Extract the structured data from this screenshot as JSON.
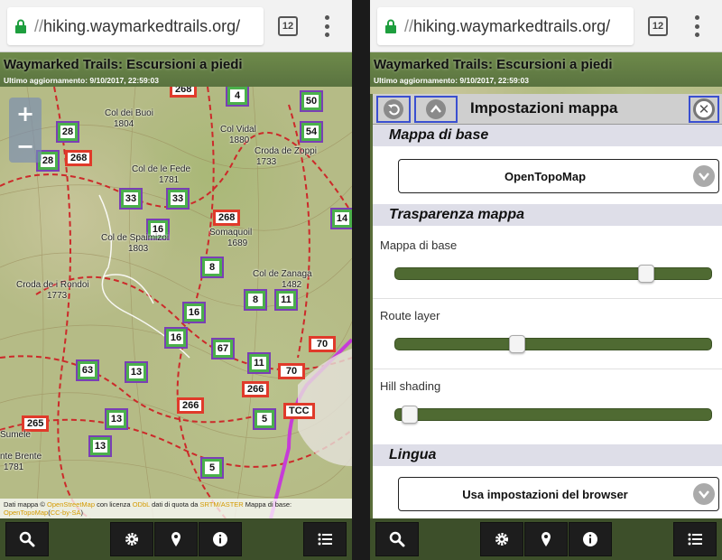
{
  "browser": {
    "url_scheme": "//",
    "url_host": "hiking.waymarkedtrails.org/",
    "tab_count": "12"
  },
  "header": {
    "title": "Waymarked Trails: Escursioni a piedi",
    "subtitle": "Ultimo aggiornamento: 9/10/2017, 22:59:03"
  },
  "map": {
    "zoom_in": "+",
    "zoom_out": "−",
    "routes_green": [
      "4",
      "50",
      "28",
      "54",
      "28",
      "33",
      "33",
      "16",
      "8",
      "8",
      "11",
      "16",
      "16",
      "67",
      "11",
      "63",
      "13",
      "13",
      "13",
      "5",
      "5",
      "14"
    ],
    "routes_red": [
      "268",
      "268",
      "268",
      "266",
      "266",
      "265",
      "70",
      "70",
      "TCC"
    ],
    "places": [
      "Col dei Buoi",
      "1804",
      "Col Vidal",
      "1880",
      "Croda de Zoppi",
      "1733",
      "Col de le Fede",
      "1781",
      "Col de Spaimizoi",
      "1803",
      "Somaquoil",
      "1689",
      "Col de Zanaga",
      "1482",
      "Croda de i Rondoi",
      "1773",
      "Sumele",
      "nte Brente",
      "1781"
    ],
    "attribution": {
      "p1": "Dati mappa © ",
      "l1": "OpenStreetMap",
      "p2": " con licenza ",
      "l2": "ODbL",
      "p3": " dati di quota da ",
      "l3": "SRTM/ASTER",
      "p4": " Mappa di base: ",
      "l4": "OpenTopoMap",
      "p5": "(",
      "l5": "CC-by-SA",
      "p6": ")"
    }
  },
  "settings": {
    "title": "Impostazioni mappa",
    "section_base": "Mappa di base",
    "base_selected": "OpenTopoMap",
    "section_transparency": "Trasparenza mappa",
    "sliders": [
      {
        "label": "Mappa di base",
        "value": 0.81
      },
      {
        "label": "Route layer",
        "value": 0.38
      },
      {
        "label": "Hill shading",
        "value": 0.02
      }
    ],
    "section_language": "Lingua",
    "language_selected": "Usa impostazioni del browser"
  },
  "colors": {
    "accent_green": "#4f6a32",
    "route_green": "#4bb04b",
    "route_red": "#e03a2a",
    "route_purple": "#7a3fb5",
    "focus_blue": "#3a4fd0"
  },
  "icons": [
    "lock-icon",
    "tabs-icon",
    "overflow-menu-icon",
    "search-icon",
    "gear-icon",
    "location-pin-icon",
    "info-icon",
    "list-icon",
    "undo-icon",
    "chevron-up-icon",
    "close-icon",
    "chevron-down-icon"
  ]
}
